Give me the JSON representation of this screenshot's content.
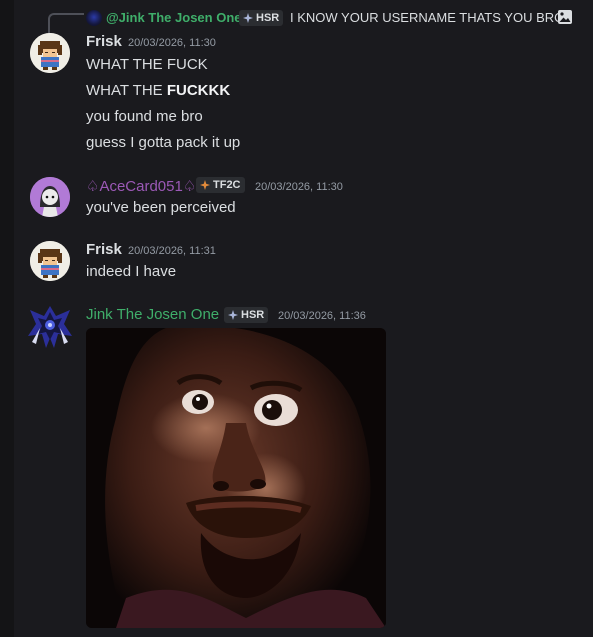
{
  "reply": {
    "author": "@Jink The Josen One",
    "tag": "HSR",
    "text": "I KNOW YOUR USERNAME THATS YOU BRO"
  },
  "messages": [
    {
      "author": "Frisk",
      "author_color": "#f2f3f5",
      "timestamp": "20/03/2026, 11:30",
      "lines": [
        {
          "pre": "WHAT THE FUCK",
          "bold": ""
        },
        {
          "pre": "WHAT THE ",
          "bold": "FUCKKK"
        },
        {
          "pre": "you found me bro",
          "bold": ""
        },
        {
          "pre": "guess I gotta pack it up",
          "bold": ""
        }
      ]
    },
    {
      "author": "♤AceCard051♤",
      "author_color": "#9b59b6",
      "tag": "TF2C",
      "timestamp": "20/03/2026, 11:30",
      "lines": [
        {
          "pre": "you've been perceived",
          "bold": ""
        }
      ]
    },
    {
      "author": "Frisk",
      "author_color": "#f2f3f5",
      "timestamp": "20/03/2026, 11:31",
      "lines": [
        {
          "pre": "indeed I have",
          "bold": ""
        }
      ]
    },
    {
      "author": "Jink The Josen One",
      "author_color": "#3fae6a",
      "tag": "HSR",
      "timestamp": "20/03/2026, 11:36",
      "lines": []
    }
  ],
  "icons": {
    "reply_image": "image-icon",
    "tag_glyph": "diamond-sparkle-icon"
  }
}
